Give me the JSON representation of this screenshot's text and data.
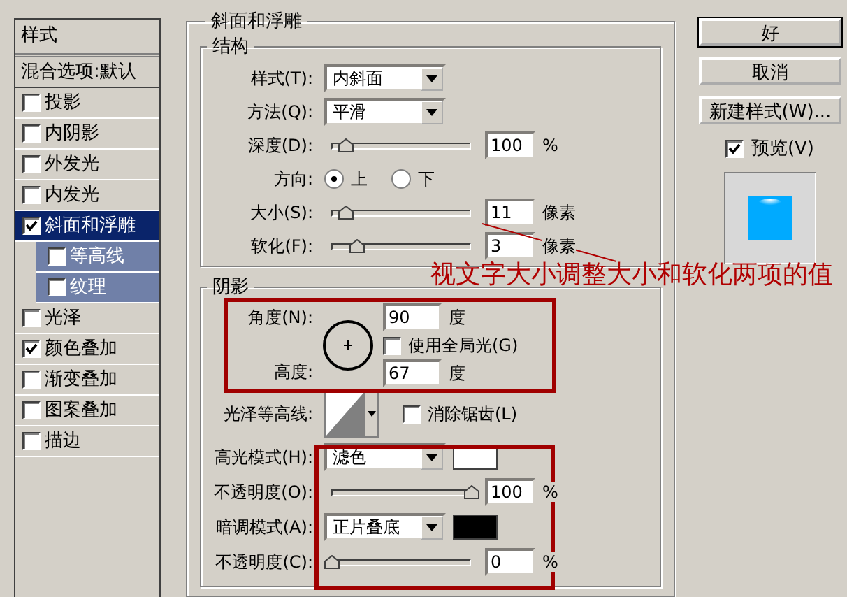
{
  "sidebar": {
    "title": "样式",
    "items": [
      {
        "kind": "header",
        "label": "混合选项:默认",
        "selected": false
      },
      {
        "kind": "effect",
        "label": "投影",
        "checked": false,
        "selected": false
      },
      {
        "kind": "effect",
        "label": "内阴影",
        "checked": false,
        "selected": false
      },
      {
        "kind": "effect",
        "label": "外发光",
        "checked": false,
        "selected": false
      },
      {
        "kind": "effect",
        "label": "内发光",
        "checked": false,
        "selected": false
      },
      {
        "kind": "effect",
        "label": "斜面和浮雕",
        "checked": true,
        "selected": true,
        "children": [
          {
            "label": "等高线",
            "checked": false
          },
          {
            "label": "纹理",
            "checked": false
          }
        ]
      },
      {
        "kind": "effect",
        "label": "光泽",
        "checked": false,
        "selected": false
      },
      {
        "kind": "effect",
        "label": "颜色叠加",
        "checked": true,
        "selected": false
      },
      {
        "kind": "effect",
        "label": "渐变叠加",
        "checked": false,
        "selected": false
      },
      {
        "kind": "effect",
        "label": "图案叠加",
        "checked": false,
        "selected": false
      },
      {
        "kind": "effect",
        "label": "描边",
        "checked": false,
        "selected": false
      }
    ]
  },
  "panel": {
    "title": "斜面和浮雕",
    "structure": {
      "title": "结构",
      "rows": [
        {
          "kind": "select",
          "label": "样式(T):",
          "value": "内斜面"
        },
        {
          "kind": "select",
          "label": "方法(Q):",
          "value": "平滑"
        },
        {
          "kind": "slider",
          "label": "深度(D):",
          "level": 0.1,
          "value": "100",
          "unit": "%"
        },
        {
          "kind": "radio",
          "label": "方向:",
          "options": [
            {
              "label": "上",
              "selected": true
            },
            {
              "label": "下",
              "selected": false
            }
          ]
        },
        {
          "kind": "slider",
          "label": "大小(S):",
          "level": 0.1,
          "value": "11",
          "unit": "像素"
        },
        {
          "kind": "slider",
          "label": "软化(F):",
          "level": 0.18,
          "value": "3",
          "unit": "像素"
        }
      ]
    },
    "shading": {
      "title": "阴影",
      "angle": {
        "label": "角度(N):",
        "value": "90",
        "unit": "度"
      },
      "global_light": {
        "label": "使用全局光(G)",
        "checked": false
      },
      "altitude": {
        "label": "高度:",
        "value": "67",
        "unit": "度"
      },
      "gloss_contour": {
        "label": "光泽等高线:"
      },
      "anti_aliased": {
        "label": "消除锯齿(L)",
        "checked": false
      },
      "rows": [
        {
          "kind": "mode",
          "label": "高光模式(H):",
          "value": "滤色",
          "color": "#ffffff"
        },
        {
          "kind": "slider",
          "label": "不透明度(O):",
          "level": 1,
          "value": "100",
          "unit": "%"
        },
        {
          "kind": "mode",
          "label": "暗调模式(A):",
          "value": "正片叠底",
          "color": "#000000"
        },
        {
          "kind": "slider",
          "label": "不透明度(C):",
          "level": 0,
          "value": "0",
          "unit": "%"
        }
      ]
    }
  },
  "buttons": [
    {
      "label": "好",
      "default": true
    },
    {
      "label": "取消",
      "default": false
    },
    {
      "label": "新建样式(W)...",
      "default": false
    }
  ],
  "preview": {
    "label": "预览(V)",
    "checked": true
  },
  "annotation": {
    "text": "视文字大小调整大小和软化两项的值"
  }
}
